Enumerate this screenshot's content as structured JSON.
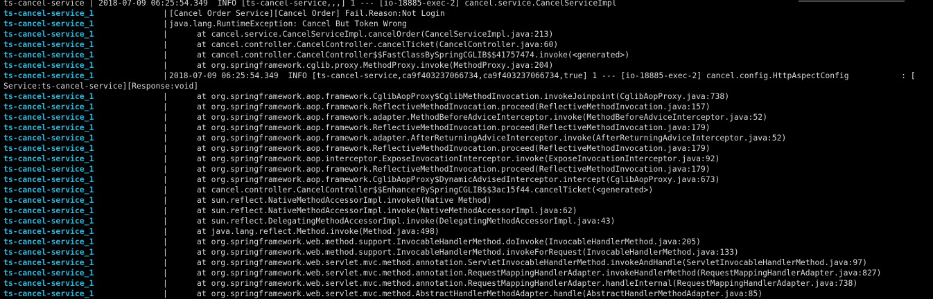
{
  "colors": {
    "background": "#000000",
    "service_name": "#29b8db",
    "text": "#d8d8d8"
  },
  "top_partial": "ts-cancel-service | 2018-07-09 06:25:54.349  INFO [ts-cancel-service,,,] 1 --- [io-18885-exec-2] cancel.service.CancelServiceImpl",
  "pipe": "|",
  "lines": [
    {
      "service": "ts-cancel-service_1",
      "text": "[Cancel Order Service][Cancel Order] Fail.Reason:Not Login",
      "indent": false
    },
    {
      "service": "ts-cancel-service_1",
      "text": "java.lang.RuntimeException: Cancel But Token Wrong",
      "indent": false
    },
    {
      "service": "ts-cancel-service_1",
      "text": "at cancel.service.CancelServiceImpl.cancelOrder(CancelServiceImpl.java:213)",
      "indent": true
    },
    {
      "service": "ts-cancel-service_1",
      "text": "at cancel.controller.CancelController.cancelTicket(CancelController.java:60)",
      "indent": true
    },
    {
      "service": "ts-cancel-service_1",
      "text": "at cancel.controller.CancelController$$FastClassBySpringCGLIB$$41757474.invoke(<generated>)",
      "indent": true
    },
    {
      "service": "ts-cancel-service_1",
      "text": "at org.springframework.cglib.proxy.MethodProxy.invoke(MethodProxy.java:204)",
      "indent": true
    },
    {
      "service": "ts-cancel-service_1",
      "text": "2018-07-09 06:25:54.349  INFO [ts-cancel-service,ca9f403237066734,ca9f403237066734,true] 1 --- [io-18885-exec-2] cancel.config.HttpAspectConfig           : [",
      "indent": false
    },
    {
      "service": "",
      "text": "Service:ts-cancel-service][Response:void]",
      "indent": false,
      "wrap": true
    },
    {
      "service": "ts-cancel-service_1",
      "text": "at org.springframework.aop.framework.CglibAopProxy$CglibMethodInvocation.invokeJoinpoint(CglibAopProxy.java:738)",
      "indent": true
    },
    {
      "service": "ts-cancel-service_1",
      "text": "at org.springframework.aop.framework.ReflectiveMethodInvocation.proceed(ReflectiveMethodInvocation.java:157)",
      "indent": true
    },
    {
      "service": "ts-cancel-service_1",
      "text": "at org.springframework.aop.framework.adapter.MethodBeforeAdviceInterceptor.invoke(MethodBeforeAdviceInterceptor.java:52)",
      "indent": true
    },
    {
      "service": "ts-cancel-service_1",
      "text": "at org.springframework.aop.framework.ReflectiveMethodInvocation.proceed(ReflectiveMethodInvocation.java:179)",
      "indent": true
    },
    {
      "service": "ts-cancel-service_1",
      "text": "at org.springframework.aop.framework.adapter.AfterReturningAdviceInterceptor.invoke(AfterReturningAdviceInterceptor.java:52)",
      "indent": true
    },
    {
      "service": "ts-cancel-service_1",
      "text": "at org.springframework.aop.framework.ReflectiveMethodInvocation.proceed(ReflectiveMethodInvocation.java:179)",
      "indent": true
    },
    {
      "service": "ts-cancel-service_1",
      "text": "at org.springframework.aop.interceptor.ExposeInvocationInterceptor.invoke(ExposeInvocationInterceptor.java:92)",
      "indent": true
    },
    {
      "service": "ts-cancel-service_1",
      "text": "at org.springframework.aop.framework.ReflectiveMethodInvocation.proceed(ReflectiveMethodInvocation.java:179)",
      "indent": true
    },
    {
      "service": "ts-cancel-service_1",
      "text": "at org.springframework.aop.framework.CglibAopProxy$DynamicAdvisedInterceptor.intercept(CglibAopProxy.java:673)",
      "indent": true
    },
    {
      "service": "ts-cancel-service_1",
      "text": "at cancel.controller.CancelController$$EnhancerBySpringCGLIB$$3ac15f44.cancelTicket(<generated>)",
      "indent": true
    },
    {
      "service": "ts-cancel-service_1",
      "text": "at sun.reflect.NativeMethodAccessorImpl.invoke0(Native Method)",
      "indent": true
    },
    {
      "service": "ts-cancel-service_1",
      "text": "at sun.reflect.NativeMethodAccessorImpl.invoke(NativeMethodAccessorImpl.java:62)",
      "indent": true
    },
    {
      "service": "ts-cancel-service_1",
      "text": "at sun.reflect.DelegatingMethodAccessorImpl.invoke(DelegatingMethodAccessorImpl.java:43)",
      "indent": true
    },
    {
      "service": "ts-cancel-service_1",
      "text": "at java.lang.reflect.Method.invoke(Method.java:498)",
      "indent": true
    },
    {
      "service": "ts-cancel-service_1",
      "text": "at org.springframework.web.method.support.InvocableHandlerMethod.doInvoke(InvocableHandlerMethod.java:205)",
      "indent": true
    },
    {
      "service": "ts-cancel-service_1",
      "text": "at org.springframework.web.method.support.InvocableHandlerMethod.invokeForRequest(InvocableHandlerMethod.java:133)",
      "indent": true
    },
    {
      "service": "ts-cancel-service_1",
      "text": "at org.springframework.web.servlet.mvc.method.annotation.ServletInvocableHandlerMethod.invokeAndHandle(ServletInvocableHandlerMethod.java:97)",
      "indent": true
    },
    {
      "service": "ts-cancel-service_1",
      "text": "at org.springframework.web.servlet.mvc.method.annotation.RequestMappingHandlerAdapter.invokeHandlerMethod(RequestMappingHandlerAdapter.java:827)",
      "indent": true
    },
    {
      "service": "ts-cancel-service_1",
      "text": "at org.springframework.web.servlet.mvc.method.annotation.RequestMappingHandlerAdapter.handleInternal(RequestMappingHandlerAdapter.java:738)",
      "indent": true
    },
    {
      "service": "ts-cancel-service_1",
      "text": "at org.springframework.web.servlet.mvc.method.AbstractHandlerMethodAdapter.handle(AbstractHandlerMethodAdapter.java:85)",
      "indent": true
    }
  ]
}
